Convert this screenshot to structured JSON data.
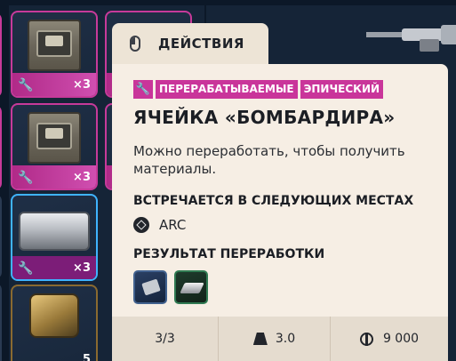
{
  "inventory": {
    "slots": [
      {
        "qty": "×3"
      },
      {
        "qty": "×3"
      },
      {
        "qty": "×3"
      },
      {
        "qty": "5"
      }
    ]
  },
  "actions_tab": {
    "label": "ДЕЙСТВИЯ"
  },
  "tooltip": {
    "tags": [
      "ПЕРЕРАБАТЫВАЕМЫЕ",
      "ЭПИЧЕСКИЙ"
    ],
    "tag_color": "#c9359a",
    "title": "ЯЧЕЙКА «БОМБАРДИРА»",
    "description": "Можно переработать, чтобы получить материалы.",
    "found_in_heading": "ВСТРЕЧАЕТСЯ В СЛЕДУЮЩИХ МЕСТАХ",
    "found_in": "ARC",
    "recycle_heading": "РЕЗУЛЬТАТ ПЕРЕРАБОТКИ",
    "footer": {
      "stack": "3/3",
      "weight": "3.0",
      "price": "9 000"
    }
  }
}
